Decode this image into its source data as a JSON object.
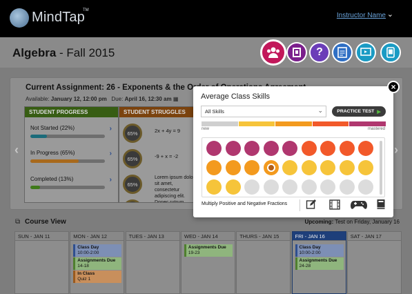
{
  "topbar": {
    "logo_text": "MindTap",
    "logo_tm": "TM",
    "instructor": "Instructor Name"
  },
  "course": {
    "name": "Algebra",
    "term": " - Fall 2015"
  },
  "tools": [
    {
      "icon": "people-icon",
      "color": "#c2185b"
    },
    {
      "icon": "book-icon",
      "color": "#7b1f8c"
    },
    {
      "icon": "question-icon",
      "color": "#6b3db8"
    },
    {
      "icon": "document-icon",
      "color": "#2f6fc4"
    },
    {
      "icon": "presentation-icon",
      "color": "#1a9bc4"
    },
    {
      "icon": "device-icon",
      "color": "#1a9bc4"
    }
  ],
  "assignment": {
    "title": "Current Assignment: 26 - Exponents & the Order of Operations Agreement",
    "available_label": "Available:",
    "available": "January 12, 12:00 pm",
    "due_label": "Due:",
    "due": "April 16, 12:30 am"
  },
  "progress": {
    "header": "STUDENT PROGRESS",
    "items": [
      {
        "label": "Not Started (22%)",
        "value": 22,
        "color": "#1b6b7a"
      },
      {
        "label": "In Progress (65%)",
        "value": 65,
        "color": "#a8691c"
      },
      {
        "label": "Completed (13%)",
        "value": 13,
        "color": "#3f7a1a"
      }
    ]
  },
  "struggles": {
    "header": "STUDENT STRUGGLES",
    "items": [
      {
        "pct": "65%",
        "text": "2x + 4y = 9"
      },
      {
        "pct": "65%",
        "text": "-9 + x = -2"
      },
      {
        "pct": "65%",
        "text": "Lorem ipsum dolor sit amet, consectetur adipiscing elit. Donec rutrum auctor enim faucibus"
      },
      {
        "pct": ""
      }
    ]
  },
  "course_view": {
    "title": "Course View",
    "upcoming_label": "Upcoming:",
    "upcoming_text": "Test on Friday, January 16",
    "days": [
      {
        "label": "SUN - JAN 11",
        "events": []
      },
      {
        "label": "MON - JAN 12",
        "events": [
          {
            "title": "Class Day",
            "sub": "10:00-2:00",
            "type": "class"
          },
          {
            "title": "Assignments Due",
            "sub": "14-18",
            "type": "assign"
          },
          {
            "title": "In Class",
            "sub": "Quiz 1",
            "type": "quiz"
          }
        ]
      },
      {
        "label": "TUES - JAN 13",
        "events": []
      },
      {
        "label": "WED - JAN 14",
        "events": [
          {
            "title": "Assignments Due",
            "sub": "19-23",
            "type": "assign"
          }
        ]
      },
      {
        "label": "THURS - JAN 15",
        "events": []
      },
      {
        "label": "FRI - JAN 16",
        "events": [
          {
            "title": "Class Day",
            "sub": "10:00-2:00",
            "type": "class"
          },
          {
            "title": "Assignments Due",
            "sub": "24-28",
            "type": "assign"
          }
        ]
      },
      {
        "label": "SAT - JAN 17",
        "events": []
      }
    ]
  },
  "modal": {
    "title": "Average Class Skills",
    "select_value": "All Skills",
    "practice_label": "PRACTICE TEST",
    "legend_new": "new",
    "legend_mastered": "mastered",
    "legend_colors": [
      "#cfcfcf",
      "#f6c43a",
      "#f39a1e",
      "#f2592a",
      "#b0376f"
    ],
    "skill_name": "Multiply Positive and Negative Fractions",
    "icons": [
      "edit-icon",
      "film-icon",
      "gamepad-icon",
      "book-icon"
    ],
    "rows": [
      [
        "#b0376f",
        "#b0376f",
        "#b0376f",
        "#b0376f",
        "#b0376f",
        "#f2592a",
        "#f2592a",
        "#f2592a",
        "#f2592a"
      ],
      [
        "#f39a1e",
        "#f39a1e",
        "#f39a1e",
        "#f39a1e",
        "#f6c43a",
        "#f6c43a",
        "#f6c43a",
        "#f6c43a",
        "#f6c43a"
      ],
      [
        "#f6c43a",
        "#f6c43a",
        "#dcdcdc",
        "#dcdcdc",
        "#dcdcdc",
        "#dcdcdc",
        "#dcdcdc",
        "#dcdcdc",
        "#dcdcdc"
      ]
    ],
    "selected": {
      "row": 1,
      "col": 3
    }
  }
}
